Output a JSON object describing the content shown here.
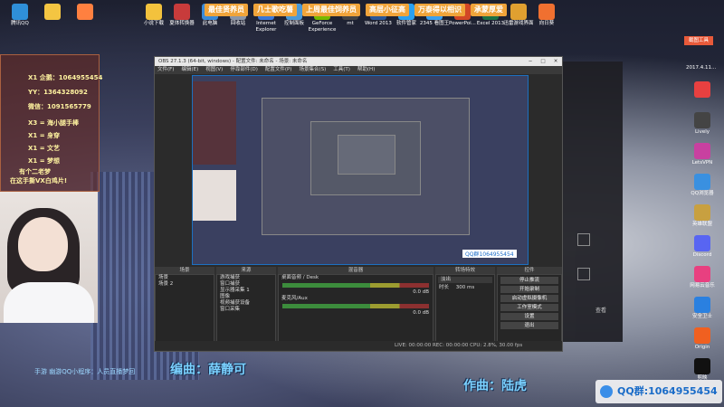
{
  "desktop": {
    "top_icons": [
      {
        "label": "腾讯QQ",
        "color": "#2f8fd8",
        "x": 0
      },
      {
        "label": "",
        "color": "#f4c542",
        "x": 1
      },
      {
        "label": "",
        "color": "#ff8040",
        "x": 2
      },
      {
        "label": "小说下载",
        "color": "#f3c23d",
        "x": 3
      },
      {
        "label": "夏体转换器",
        "color": "#c83b3b",
        "x": 4
      },
      {
        "label": "此电脑",
        "color": "#3a8ad8",
        "x": 5
      },
      {
        "label": "回收站",
        "color": "#8a96a8",
        "x": 6
      },
      {
        "label": "Internet Explorer",
        "color": "#3b78d8",
        "x": 7
      },
      {
        "label": "控制面板",
        "color": "#4a9ad8",
        "x": 8
      },
      {
        "label": "GeForce Experience",
        "color": "#76b900",
        "x": 9
      },
      {
        "label": "mt",
        "color": "#444",
        "x": 10
      },
      {
        "label": "Word 2013",
        "color": "#2b5797",
        "x": 11
      },
      {
        "label": "软件管家",
        "color": "#2aa0f0",
        "x": 12
      },
      {
        "label": "2345 看图王",
        "color": "#3ba0f0",
        "x": 13
      },
      {
        "label": "PowerPoi...",
        "color": "#d24726",
        "x": 14
      },
      {
        "label": "Excel 2013",
        "color": "#1e7145",
        "x": 15
      },
      {
        "label": "迅雷游戏界面",
        "color": "#e0a030",
        "x": 16
      },
      {
        "label": "向日葵",
        "color": "#f07030",
        "x": 17
      }
    ],
    "banner": [
      "最佳贤养员",
      "几士歌吃薯",
      "上周最佳饲养员",
      "高层小征高",
      "万泰得以相识",
      "承蒙厚爱"
    ],
    "right_icons": [
      {
        "label": "",
        "color": "#e84040"
      },
      {
        "label": "Lively",
        "color": "#444"
      },
      {
        "label": "LetsVPN",
        "color": "#c840a0"
      },
      {
        "label": "QQ浏览器",
        "color": "#3a90e0"
      },
      {
        "label": "英雄联盟",
        "color": "#c8a040"
      },
      {
        "label": "Discord",
        "color": "#5865f2"
      },
      {
        "label": "网易云音乐",
        "color": "#e84080"
      },
      {
        "label": "安全卫士",
        "color": "#2a80e0"
      },
      {
        "label": "Origin",
        "color": "#f06020"
      },
      {
        "label": "剪映",
        "color": "#111"
      }
    ],
    "right_badge": "2017.4.11...",
    "top_right_btn": "截图工具"
  },
  "left_panel": {
    "lines": [
      "X1 企鹅：1064955454",
      "YY：1364328092",
      "微信：1091565779",
      "X3 = 海小腿手棒",
      "X1 = 身穿",
      "X1 = 文艺",
      "X1 = 梦想",
      "有个二老梦",
      "在这手撕VX白鸡片!"
    ]
  },
  "obs": {
    "title": "OBS 27.1.3 (64-bit, windows) - 配置文件: 未命名 - 场景: 未命名",
    "menu": [
      "文件(F)",
      "编辑(E)",
      "视图(V)",
      "停靠部件(D)",
      "配置文件(P)",
      "场景集合(S)",
      "工具(T)",
      "帮助(H)"
    ],
    "dock_titles": {
      "scenes": "场景",
      "sources": "来源",
      "mixer": "混音器",
      "transitions": "转场特效",
      "controls": "控件"
    },
    "scenes": [
      "场景",
      "场景 2"
    ],
    "sources": [
      "游戏捕获",
      "窗口捕获",
      "显示器采集 1",
      "图像",
      "视频捕获设备",
      "窗口采集"
    ],
    "mixer": [
      {
        "name": "桌面音频 / Desk",
        "db": "0.0 dB"
      },
      {
        "name": "麦克风/Aux",
        "db": "0.0 dB"
      }
    ],
    "transition": {
      "name": "淡出",
      "duration_label": "时长",
      "duration": "300 ms"
    },
    "controls": [
      "停止推流",
      "开始录制",
      "启动虚拟摄像机",
      "工作室模式",
      "设置",
      "退出"
    ],
    "status": "LIVE: 00:00:00   REC: 00:00:00   CPU: 2.8%, 30.00 fps",
    "live_user": "QQ群1064955454"
  },
  "right_window": {
    "sidebar_text": "查看"
  },
  "subtitles": {
    "left": "编曲：薛静可",
    "right": "作曲：陆虎"
  },
  "qq_badge": "QQ群:1064955454",
  "bottom_note": "手游 幽游QQ小程序：人员直播梦回"
}
